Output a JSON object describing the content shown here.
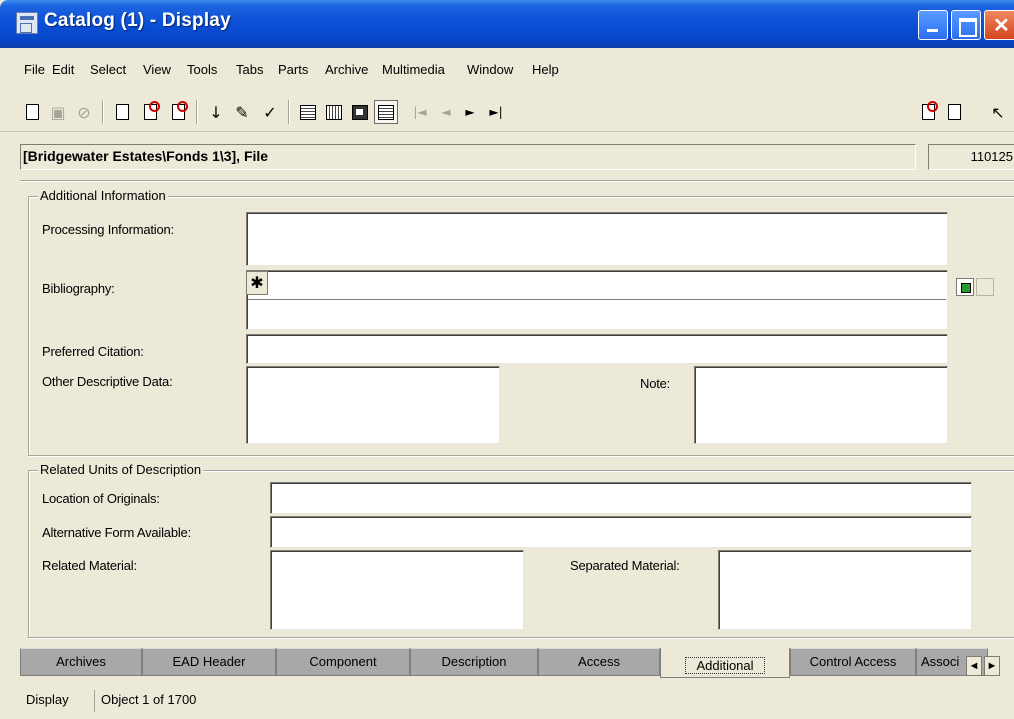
{
  "window": {
    "title": "Catalog (1) - Display"
  },
  "menu": [
    {
      "label": "File"
    },
    {
      "label": "Edit"
    },
    {
      "label": "Select"
    },
    {
      "label": "View"
    },
    {
      "label": "Tools"
    },
    {
      "label": "Tabs"
    },
    {
      "label": "Parts"
    },
    {
      "label": "Archive"
    },
    {
      "label": "Multimedia"
    },
    {
      "label": "Window"
    },
    {
      "label": "Help"
    }
  ],
  "toolbar": {
    "icons": [
      "new-icon",
      "save-icon",
      "cancel-icon",
      "edit-record-icon",
      "delete-record-icon",
      "new-record-icon",
      "sort-icon",
      "edit-icon",
      "spellcheck-icon",
      "form-view-icon",
      "grid-view-icon",
      "list-view-icon",
      "page-view-icon",
      "first-record-icon",
      "previous-record-icon",
      "next-record-icon",
      "last-record-icon",
      "report-icon",
      "copy-icon",
      "help-pointer-icon"
    ]
  },
  "record": {
    "path": "[Bridgewater Estates\\Fonds 1\\3], File",
    "number": "110125"
  },
  "additional_info": {
    "title": "Additional Information",
    "processing_label": "Processing Information:",
    "processing_value": "",
    "bibliography_label": "Bibliography:",
    "bibliography_marker": "✱",
    "bibliography_value": "",
    "preferred_citation_label": "Preferred Citation:",
    "preferred_citation_value": "",
    "other_descriptive_label": "Other Descriptive Data:",
    "other_descriptive_value": "",
    "note_label": "Note:",
    "note_value": ""
  },
  "related_units": {
    "title": "Related Units of Description",
    "location_label": "Location of Originals:",
    "location_value": "",
    "alternative_label": "Alternative Form Available:",
    "alternative_value": "",
    "related_label": "Related Material:",
    "related_value": "",
    "separated_label": "Separated Material:",
    "separated_value": ""
  },
  "tabs": [
    {
      "label": "Archives"
    },
    {
      "label": "EAD Header"
    },
    {
      "label": "Component"
    },
    {
      "label": "Description"
    },
    {
      "label": "Access"
    },
    {
      "label": "Additional",
      "active": true
    },
    {
      "label": "Control Access"
    },
    {
      "label": "Associ"
    }
  ],
  "tab_scroll": {
    "left": "◄",
    "right": "►"
  },
  "status": {
    "mode": "Display",
    "position": "Object 1 of 1700"
  }
}
